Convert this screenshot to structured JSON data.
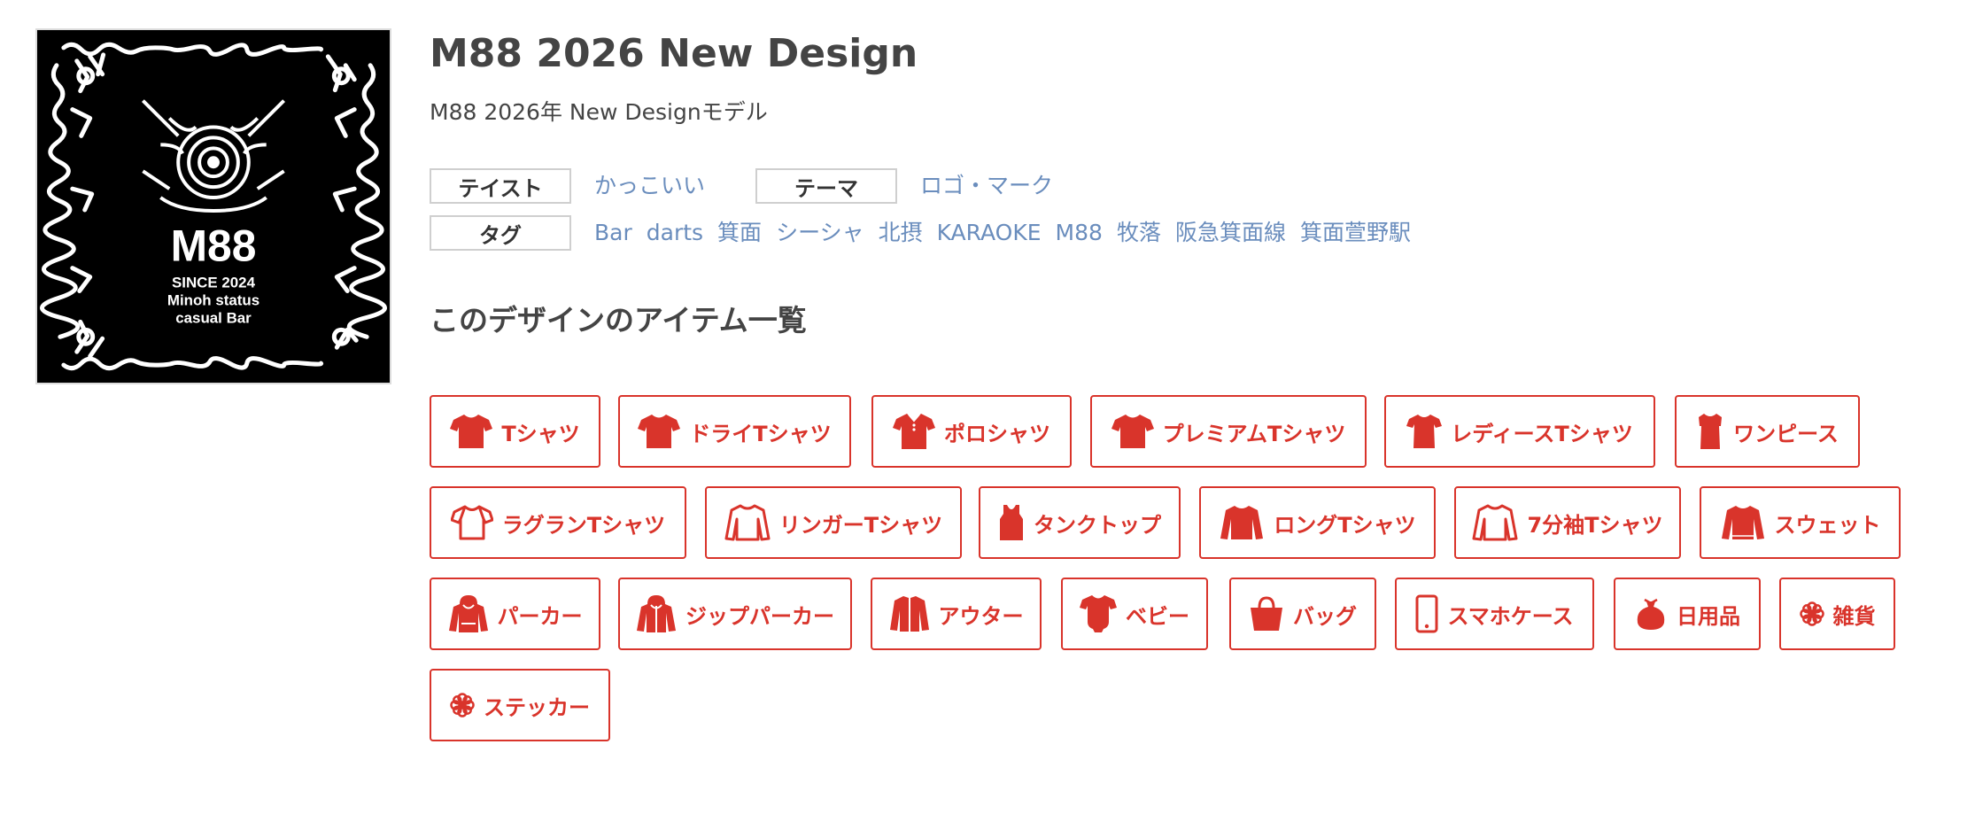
{
  "design": {
    "image_alt": "M88 logo",
    "image_text": {
      "logo": "M88",
      "line1": "SINCE 2024",
      "line2": "Minoh status",
      "line3": "casual Bar"
    },
    "title": "M88 2026 New Design",
    "subtitle": "M88 2026年 New Designモデル"
  },
  "meta": {
    "taste_label": "テイスト",
    "taste_value": "かっこいい",
    "theme_label": "テーマ",
    "theme_value": "ロゴ・マーク",
    "tags_label": "タグ",
    "tags": [
      "Bar",
      "darts",
      "箕面",
      "シーシャ",
      "北摂",
      "KARAOKE",
      "M88",
      "牧落",
      "阪急箕面線",
      "箕面萱野駅"
    ]
  },
  "items_heading": "このデザインのアイテム一覧",
  "items": [
    {
      "label": "Tシャツ",
      "icon": "tshirt-icon"
    },
    {
      "label": "ドライTシャツ",
      "icon": "tshirt-icon"
    },
    {
      "label": "ポロシャツ",
      "icon": "polo-shirt-icon"
    },
    {
      "label": "プレミアムTシャツ",
      "icon": "tshirt-icon"
    },
    {
      "label": "レディースTシャツ",
      "icon": "ladies-tshirt-icon"
    },
    {
      "label": "ワンピース",
      "icon": "dress-icon"
    },
    {
      "label": "ラグランTシャツ",
      "icon": "raglan-tshirt-icon"
    },
    {
      "label": "リンガーTシャツ",
      "icon": "long-sleeve-outline-icon"
    },
    {
      "label": "タンクトップ",
      "icon": "tank-top-icon"
    },
    {
      "label": "ロングTシャツ",
      "icon": "long-sleeve-icon"
    },
    {
      "label": "7分袖Tシャツ",
      "icon": "long-sleeve-outline-icon"
    },
    {
      "label": "スウェット",
      "icon": "sweatshirt-icon"
    },
    {
      "label": "パーカー",
      "icon": "hoodie-icon"
    },
    {
      "label": "ジップパーカー",
      "icon": "zip-hoodie-icon"
    },
    {
      "label": "アウター",
      "icon": "jacket-icon"
    },
    {
      "label": "ベビー",
      "icon": "baby-bodysuit-icon"
    },
    {
      "label": "バッグ",
      "icon": "bag-icon"
    },
    {
      "label": "スマホケース",
      "icon": "smartphone-icon"
    },
    {
      "label": "日用品",
      "icon": "pouch-icon"
    },
    {
      "label": "雑貨",
      "icon": "flower-icon"
    },
    {
      "label": "ステッカー",
      "icon": "flower-icon"
    }
  ],
  "colors": {
    "accent": "#d9342b",
    "link": "#6a8dbd",
    "text": "#444444",
    "border": "#cfcfcf"
  }
}
